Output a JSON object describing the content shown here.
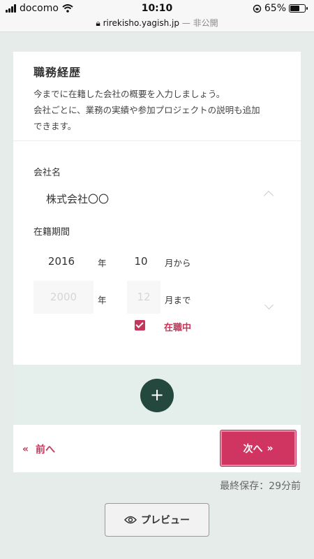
{
  "status_bar": {
    "carrier": "docomo",
    "time": "10:10",
    "battery": "65%",
    "battery_level": 0.65,
    "url": "rirekisho.yagish.jp",
    "url_suffix": "— 非公開"
  },
  "section": {
    "title": "職務経歴",
    "description": [
      "今までに在籍した会社の概要を入力しましょう。",
      "会社ごとに、業務の実績や参加プロジェクトの説明も追加",
      "できます。"
    ]
  },
  "company": {
    "label": "会社名",
    "value": "株式会社〇〇"
  },
  "period": {
    "label": "在籍期間",
    "start_year": "2016",
    "start_month": "10",
    "year_unit": "年",
    "from_suffix": "月から",
    "end_year_placeholder": "2000",
    "end_month_placeholder": "12",
    "to_suffix": "月まで",
    "currently_employed_label": "在職中",
    "currently_employed": true
  },
  "add_button": {
    "label": "+"
  },
  "nav": {
    "prev_label": "前へ",
    "prev_icon": "«",
    "next_label": "次へ",
    "next_icon": "»"
  },
  "last_saved": "最終保存：29分前",
  "preview": {
    "label": "プレビュー"
  },
  "colors": {
    "accent": "#cf3560",
    "dark_green": "#24483e",
    "background": "#e6ecea"
  }
}
